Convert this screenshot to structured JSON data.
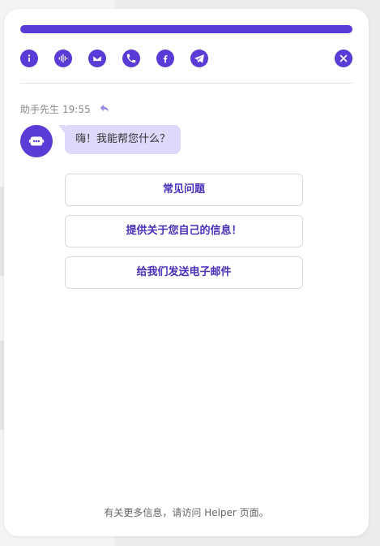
{
  "header": {
    "accent": "#5b3bd6",
    "icons": [
      "info-icon",
      "voice-icon",
      "email-icon",
      "phone-icon",
      "facebook-icon",
      "telegram-icon"
    ],
    "close_icon": "close-icon"
  },
  "message": {
    "sender": "助手先生",
    "time": "19:55",
    "text": "嗨！我能帮您什么？"
  },
  "options": [
    {
      "label": "常见问题"
    },
    {
      "label": "提供关于您自己的信息！"
    },
    {
      "label": "给我们发送电子邮件"
    }
  ],
  "footer": {
    "text": "有关更多信息，请访问 Helper 页面。"
  }
}
